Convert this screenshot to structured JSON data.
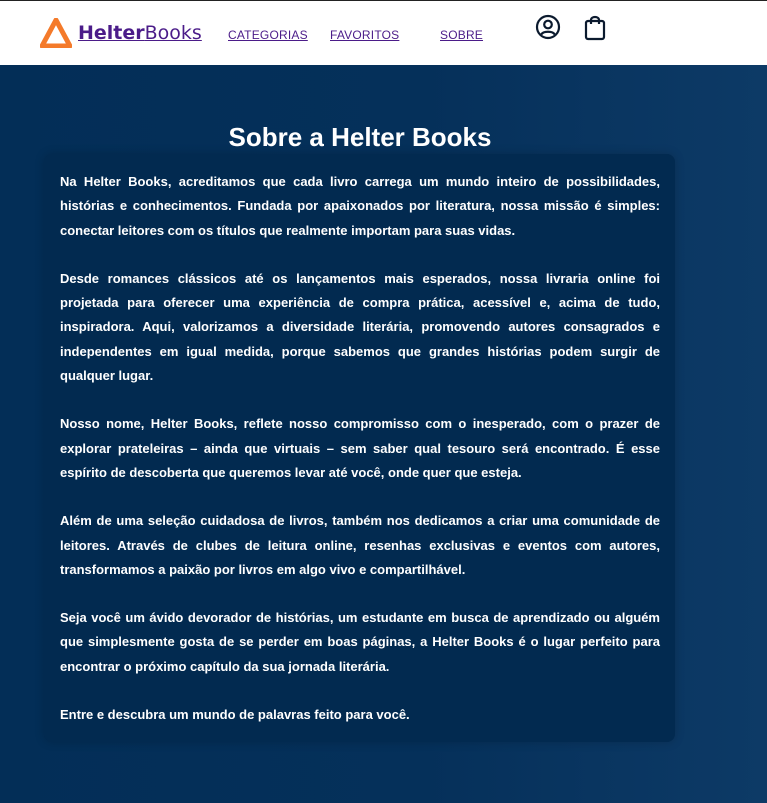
{
  "header": {
    "logo_bold": "Helter",
    "logo_light": "Books",
    "nav": [
      {
        "label": "CATEGORIAS"
      },
      {
        "label": "FAVORITOS"
      },
      {
        "label": "SOBRE"
      }
    ],
    "icons": [
      "user-circle-icon",
      "shopping-bag-icon"
    ]
  },
  "main": {
    "title": "Sobre a Helter Books",
    "paragraphs": [
      "Na Helter Books, acreditamos que cada livro carrega um mundo inteiro de possibilidades, histórias e conhecimentos. Fundada por apaixonados por literatura, nossa missão é simples: conectar leitores com os títulos que realmente importam para suas vidas.",
      "Desde romances clássicos até os lançamentos mais esperados, nossa livraria online foi projetada para oferecer uma experiência de compra prática, acessível e, acima de tudo, inspiradora. Aqui, valorizamos a diversidade literária, promovendo autores consagrados e independentes em igual medida, porque sabemos que grandes histórias podem surgir de qualquer lugar.",
      "Nosso nome, Helter Books, reflete nosso compromisso com o inesperado, com o prazer de explorar prateleiras – ainda que virtuais – sem saber qual tesouro será encontrado. É esse espírito de descoberta que queremos levar até você, onde quer que esteja.",
      "Além de uma seleção cuidadosa de livros, também nos dedicamos a criar uma comunidade de leitores. Através de clubes de leitura online, resenhas exclusivas e eventos com autores, transformamos a paixão por livros em algo vivo e compartilhável.",
      "Seja você um ávido devorador de histórias, um estudante em busca de aprendizado ou alguém que simplesmente gosta de se perder em boas páginas, a Helter Books é o lugar perfeito para encontrar o próximo capítulo da sua jornada literária.",
      "Entre e descubra um mundo de palavras feito para você."
    ]
  },
  "colors": {
    "brand_purple": "#4b1c89",
    "logo_orange": "#f47a2a",
    "background_navy": "#032e57",
    "card_navy": "#022a50",
    "text": "#ffffff"
  }
}
